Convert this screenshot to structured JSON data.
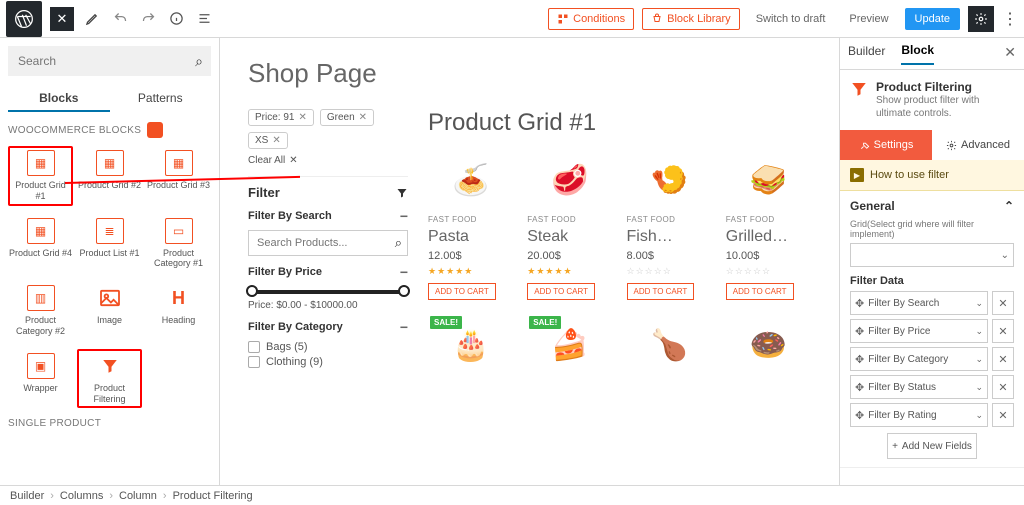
{
  "topbar": {
    "conditions": "Conditions",
    "block_library": "Block Library",
    "switch": "Switch to draft",
    "preview": "Preview",
    "update": "Update"
  },
  "inserter": {
    "search_placeholder": "Search",
    "tab_blocks": "Blocks",
    "tab_patterns": "Patterns",
    "section_woo": "WOOCOMMERCE BLOCKS",
    "section_single": "SINGLE PRODUCT",
    "blocks": {
      "grid1": "Product Grid #1",
      "grid2": "Product Grid #2",
      "grid3": "Product Grid #3",
      "grid4": "Product Grid #4",
      "list1": "Product List #1",
      "cat1": "Product Category #1",
      "cat2": "Product Category #2",
      "image": "Image",
      "heading": "Heading",
      "wrapper": "Wrapper",
      "filtering": "Product Filtering"
    }
  },
  "canvas": {
    "page_title": "Shop Page",
    "chips": {
      "price": "Price: 91",
      "green": "Green",
      "xs": "XS"
    },
    "clear_all": "Clear All",
    "filter_label": "Filter",
    "facets": {
      "search": "Filter By Search",
      "search_placeholder": "Search Products...",
      "price": "Filter By Price",
      "price_text": "Price: $0.00 - $10000.00",
      "category": "Filter By Category",
      "cat_bags": "Bags (5)",
      "cat_clothing": "Clothing (9)"
    },
    "grid_title": "Product Grid #1",
    "cat_label": "FAST FOOD",
    "add_label": "ADD TO CART",
    "sale": "SALE!",
    "products": [
      {
        "name": "Pasta",
        "price": "12.00$",
        "stars": "full"
      },
      {
        "name": "Steak",
        "price": "20.00$",
        "stars": "full"
      },
      {
        "name": "Fish…",
        "price": "8.00$",
        "stars": "empty"
      },
      {
        "name": "Grilled…",
        "price": "10.00$",
        "stars": "empty"
      }
    ]
  },
  "panel": {
    "tab_builder": "Builder",
    "tab_block": "Block",
    "block_title": "Product Filtering",
    "block_desc": "Show product filter with ultimate controls.",
    "settings": "Settings",
    "advanced": "Advanced",
    "howto": "How to use filter",
    "general": "General",
    "grid_hint": "Grid(Select grid where will filter implement)",
    "fd_label": "Filter Data",
    "fd": [
      "Filter By Search",
      "Filter By Price",
      "Filter By Category",
      "Filter By Status",
      "Filter By Rating"
    ],
    "add_field": "Add New Fields"
  },
  "crumb": [
    "Builder",
    "Columns",
    "Column",
    "Product Filtering"
  ]
}
